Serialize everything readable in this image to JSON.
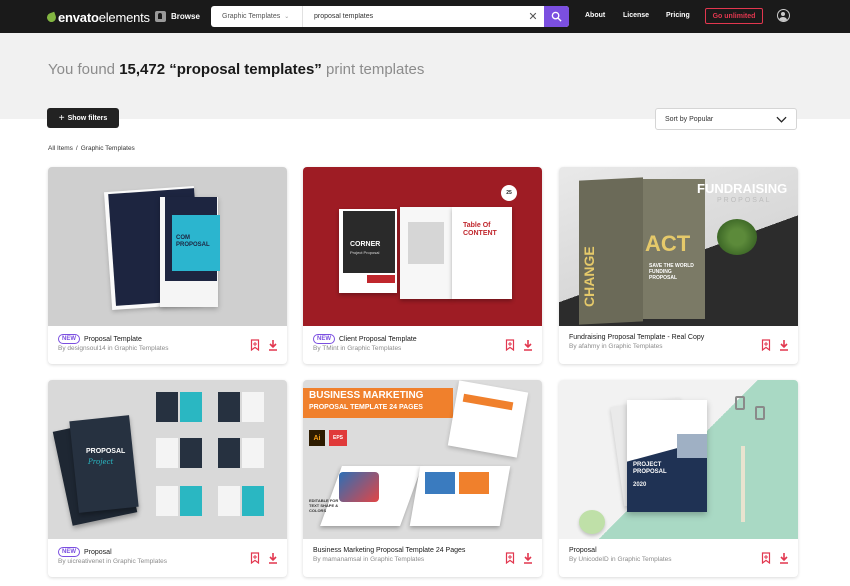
{
  "header": {
    "logo_text_prefix": "envato",
    "logo_text_suffix": "elements",
    "browse_label": "Browse",
    "category_label": "Graphic Templates",
    "search_value": "proposal templates",
    "nav": {
      "about": "About",
      "license": "License",
      "pricing": "Pricing"
    },
    "cta_label": "Go unlimited"
  },
  "results": {
    "prefix": "You found",
    "count": "15,472",
    "query": "“proposal templates”",
    "suffix": "print templates"
  },
  "toolbar": {
    "filters_label": "Show filters",
    "sort_label": "Sort by Popular"
  },
  "breadcrumb": {
    "root": "All Items",
    "separator": "/",
    "current": "Graphic Templates"
  },
  "items": [
    {
      "badge": "NEW",
      "title": "Proposal Template",
      "by": "By",
      "author": "designsoul14",
      "in": "in",
      "category": "Graphic Templates",
      "art": {
        "cover_title": "COM PROPOSAL"
      }
    },
    {
      "badge": "NEW",
      "title": "Client Proposal Template",
      "by": "By",
      "author": "TMint",
      "in": "in",
      "category": "Graphic Templates",
      "art": {
        "cover_title": "CORNER",
        "cover_sub": "Project Proposal",
        "page_title": "Table Of CONTENT",
        "page_number": "25"
      }
    },
    {
      "badge": "",
      "title": "Fundraising Proposal Template - Real Copy",
      "by": "By",
      "author": "afahmy",
      "in": "in",
      "category": "Graphic Templates",
      "art": {
        "heading": "FUNDRAISING",
        "sub": "PROPOSAL",
        "left_word": "CHANGE",
        "right_word": "ACT",
        "tagline": "SAVE THE WORLD FUNDING PROPOSAL"
      }
    },
    {
      "badge": "NEW",
      "title": "Proposal",
      "by": "By",
      "author": "uicreativenet",
      "in": "in",
      "category": "Graphic Templates",
      "art": {
        "cover_title": "PROPOSAL",
        "cover_script": "Project"
      }
    },
    {
      "badge": "",
      "title": "Business Marketing Proposal Template 24 Pages",
      "by": "By",
      "author": "mamanamsal",
      "in": "in",
      "category": "Graphic Templates",
      "art": {
        "banner_line1": "BUSINESS MARKETING",
        "banner_line2": "PROPOSAL TEMPLATE 24 PAGES",
        "ai_label": "Ai",
        "eps_label": "EPS",
        "note": "EDITABLE FOR TEXT SHAPE & COLORS"
      }
    },
    {
      "badge": "",
      "title": "Proposal",
      "by": "By",
      "author": "UnicodeID",
      "in": "in",
      "category": "Graphic Templates",
      "art": {
        "cover_title": "PROJECT PROPOSAL",
        "year": "2020"
      }
    }
  ],
  "colors": {
    "accent_purple": "#7b4fe0",
    "cta_red": "#e2374f",
    "action_red": "#e2374f",
    "logo_green": "#82b541"
  },
  "icons": [
    "search-icon",
    "clear-icon",
    "chevron-down-icon",
    "plus-icon",
    "bookmark-icon",
    "download-icon",
    "user-icon",
    "browse-icon",
    "leaf-logo-icon"
  ]
}
